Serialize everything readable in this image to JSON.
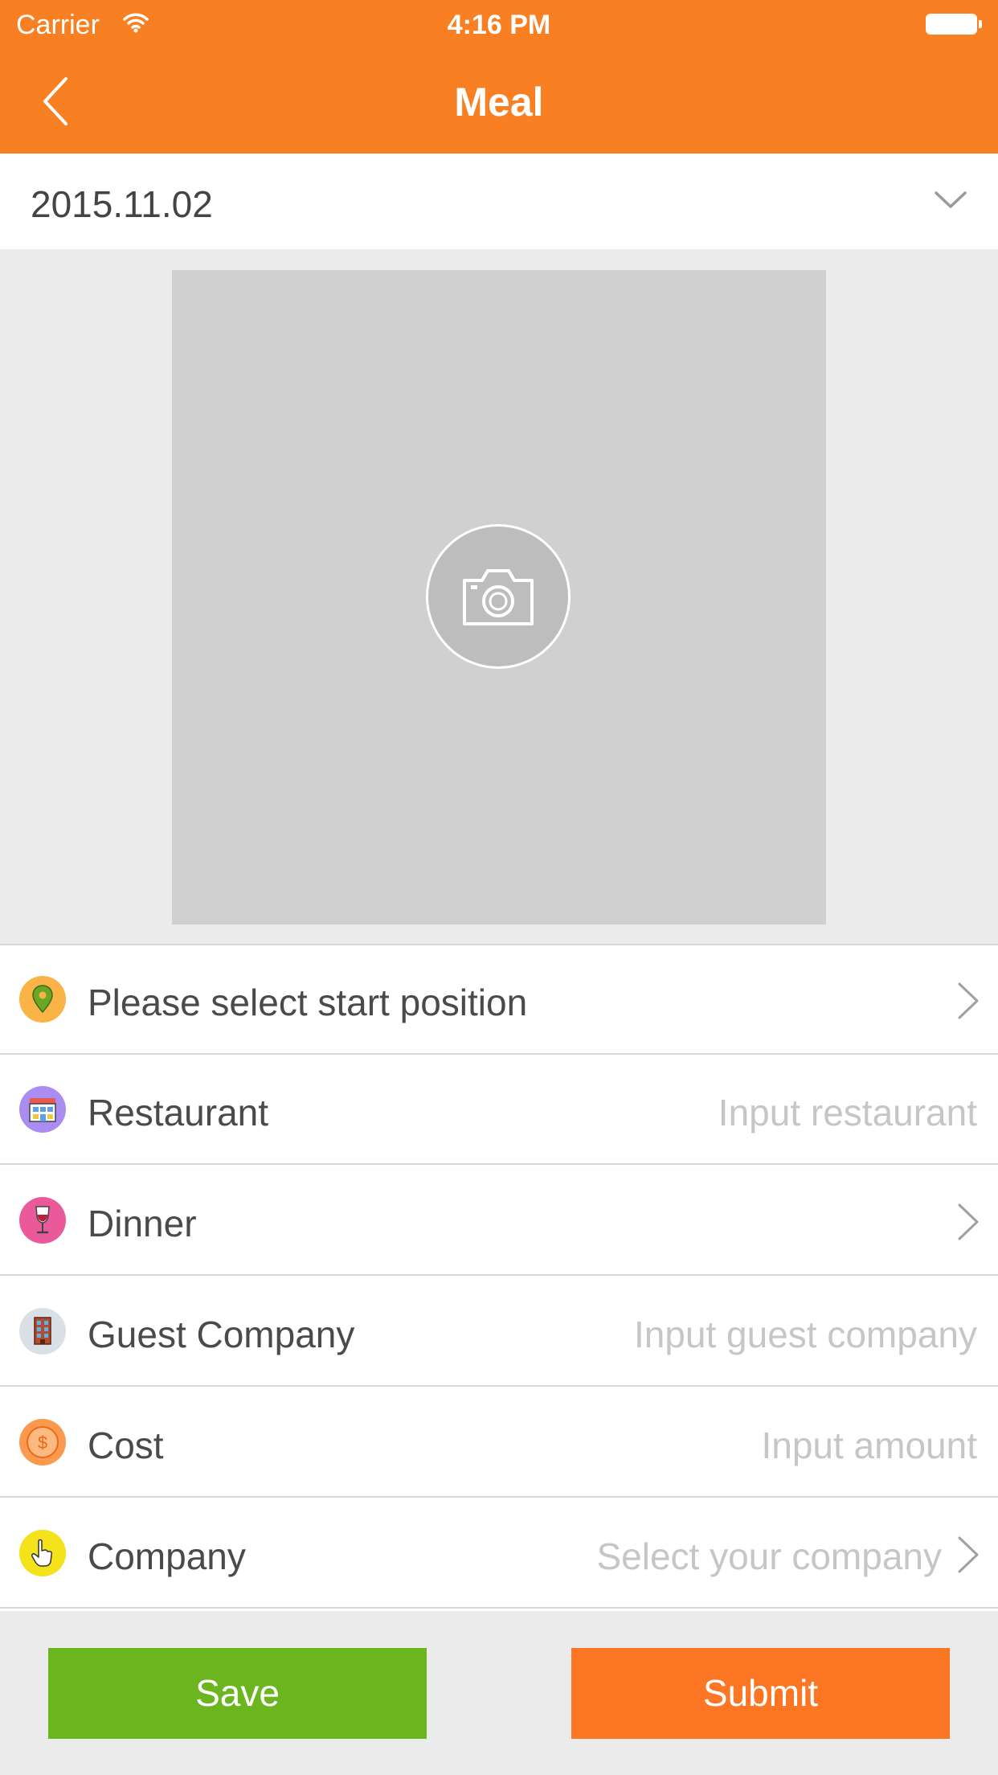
{
  "status_bar": {
    "carrier": "Carrier",
    "time": "4:16 PM"
  },
  "nav": {
    "title": "Meal",
    "back_icon": "chevron-left-icon"
  },
  "date_row": {
    "value": "2015.11.02",
    "icon": "chevron-down-icon"
  },
  "photo": {
    "icon": "camera-icon"
  },
  "form": {
    "rows": [
      {
        "label": "Please select start position",
        "value": "",
        "icon": "location-pin-icon",
        "icon_color": "#f9b347",
        "arrow": true
      },
      {
        "label": "Restaurant",
        "value": "Input restaurant",
        "icon": "restaurant-icon",
        "icon_color": "#a98df0",
        "arrow": false
      },
      {
        "label": "Dinner",
        "value": "",
        "icon": "wine-glass-icon",
        "icon_color": "#ea5a9b",
        "arrow": true
      },
      {
        "label": "Guest Company",
        "value": "Input guest company",
        "icon": "building-icon",
        "icon_color": "#d9e0e6",
        "arrow": false
      },
      {
        "label": "Cost",
        "value": "Input amount",
        "icon": "dollar-icon",
        "icon_color": "#fb9a4f",
        "arrow": false
      },
      {
        "label": "Company",
        "value": "Select your company",
        "icon": "hand-pointer-icon",
        "icon_color": "#f4e21a",
        "arrow": true
      }
    ]
  },
  "buttons": {
    "save": "Save",
    "submit": "Submit"
  },
  "colors": {
    "accent": "#f88023",
    "save": "#6bb51e",
    "submit": "#fd7624"
  }
}
